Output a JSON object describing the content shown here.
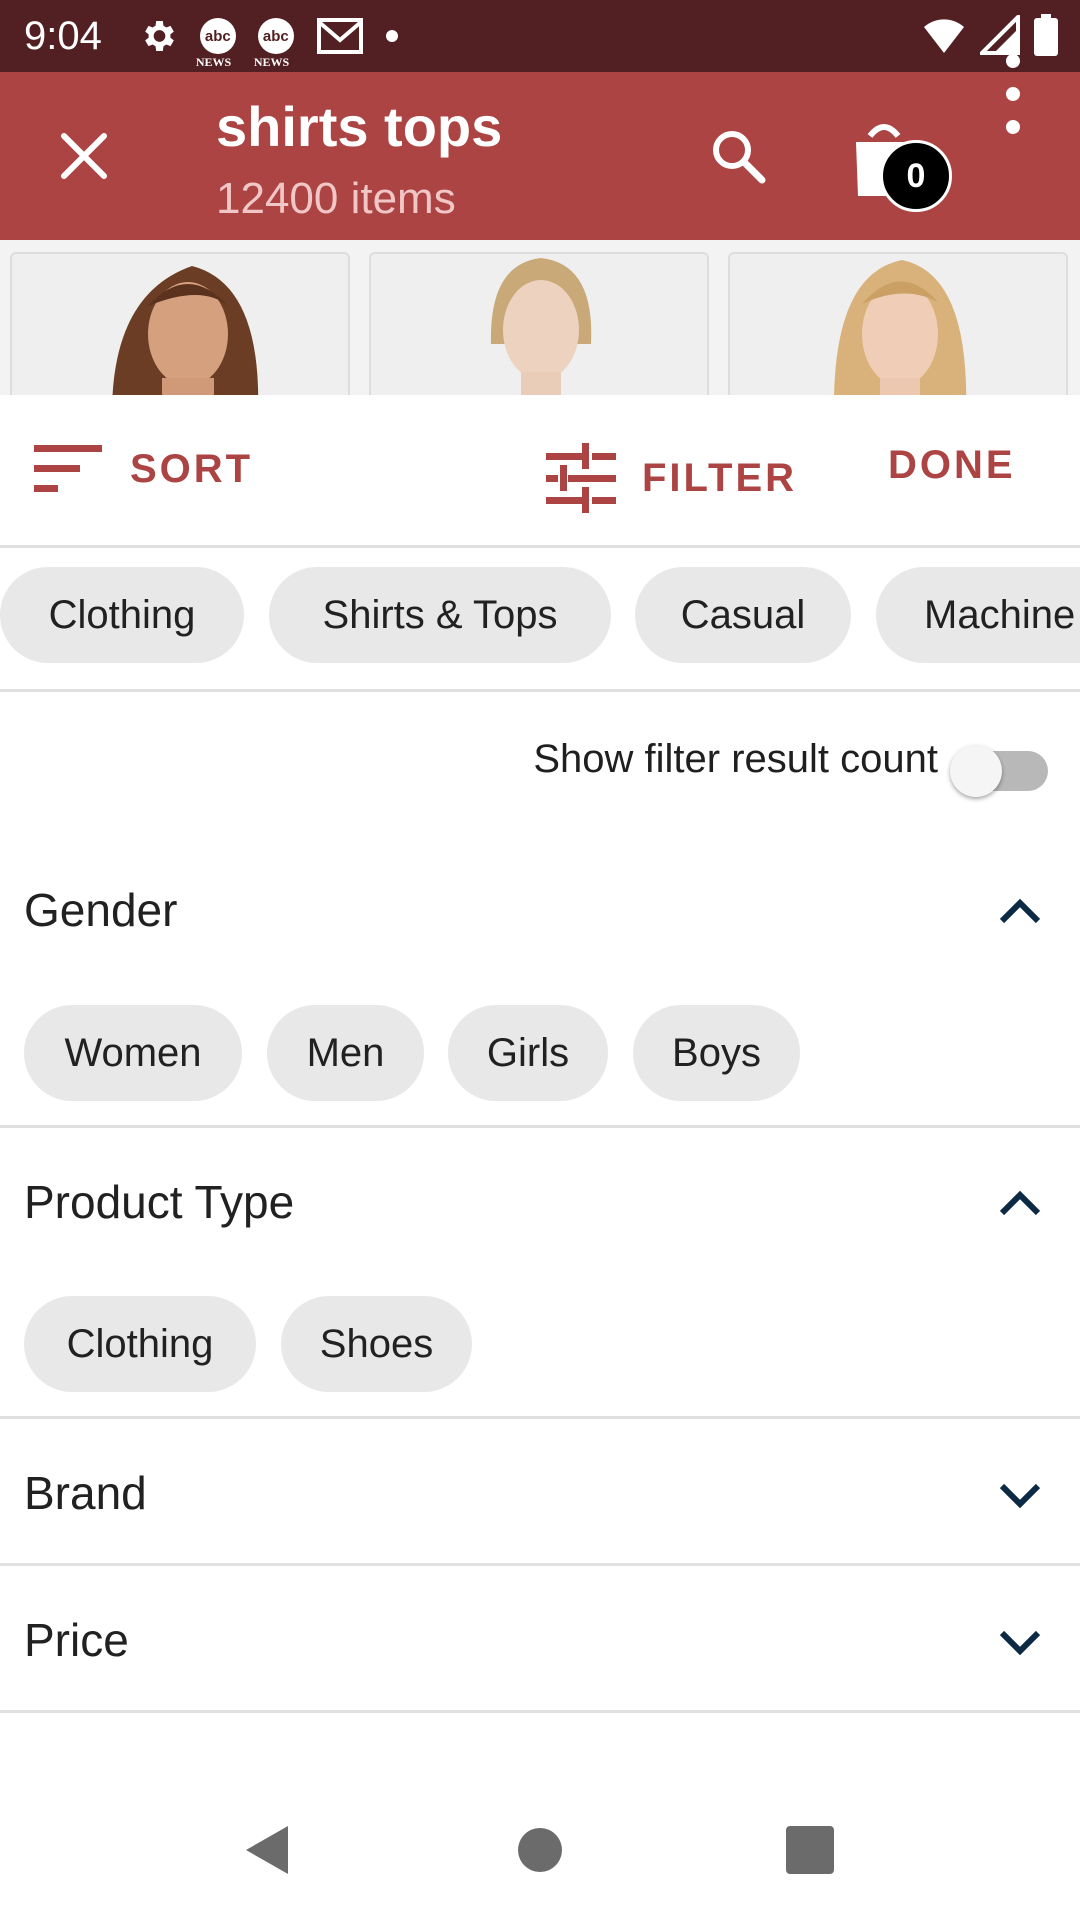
{
  "status_bar": {
    "time": "9:04",
    "abc_label": "abc",
    "news_label": "NEWS"
  },
  "app_bar": {
    "title": "shirts tops",
    "subtitle": "12400 items",
    "cart_count": "0"
  },
  "toolbar": {
    "sort_label": "SORT",
    "filter_label": "FILTER",
    "done_label": "DONE"
  },
  "applied_chips": [
    "Clothing",
    "Shirts & Tops",
    "Casual",
    "Machine"
  ],
  "toggle": {
    "label": "Show filter result count",
    "on": false
  },
  "sections": [
    {
      "title": "Gender",
      "expanded": true,
      "options": [
        "Women",
        "Men",
        "Girls",
        "Boys"
      ]
    },
    {
      "title": "Product Type",
      "expanded": true,
      "options": [
        "Clothing",
        "Shoes"
      ]
    },
    {
      "title": "Brand",
      "expanded": false
    },
    {
      "title": "Price",
      "expanded": false
    }
  ],
  "colors": {
    "brand": "#ac4444",
    "status_bar": "#522022",
    "chip": "#e8e8e8",
    "chevron": "#0d2a45"
  }
}
